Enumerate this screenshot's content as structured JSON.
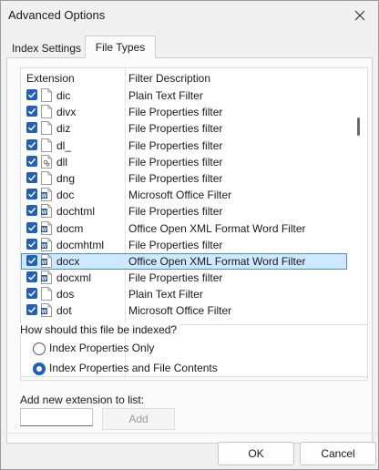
{
  "window": {
    "title": "Advanced Options"
  },
  "tabs": [
    {
      "label": "Index Settings",
      "active": false
    },
    {
      "label": "File Types",
      "active": true
    }
  ],
  "list": {
    "headers": {
      "extension": "Extension",
      "description": "Filter Description"
    },
    "rows": [
      {
        "ext": "dic",
        "desc": "Plain Text Filter",
        "checked": true,
        "icon": "blank-file-icon"
      },
      {
        "ext": "divx",
        "desc": "File Properties filter",
        "checked": true,
        "icon": "blank-file-icon"
      },
      {
        "ext": "diz",
        "desc": "File Properties filter",
        "checked": true,
        "icon": "blank-file-icon"
      },
      {
        "ext": "dl_",
        "desc": "File Properties filter",
        "checked": true,
        "icon": "blank-file-icon"
      },
      {
        "ext": "dll",
        "desc": "File Properties filter",
        "checked": true,
        "icon": "dll-file-icon"
      },
      {
        "ext": "dng",
        "desc": "File Properties filter",
        "checked": true,
        "icon": "blank-file-icon"
      },
      {
        "ext": "doc",
        "desc": "Microsoft Office Filter",
        "checked": true,
        "icon": "word-doc-icon"
      },
      {
        "ext": "dochtml",
        "desc": "File Properties filter",
        "checked": true,
        "icon": "word-doc-icon"
      },
      {
        "ext": "docm",
        "desc": "Office Open XML Format Word Filter",
        "checked": true,
        "icon": "word-doc-icon"
      },
      {
        "ext": "docmhtml",
        "desc": "File Properties filter",
        "checked": true,
        "icon": "word-doc-icon"
      },
      {
        "ext": "docx",
        "desc": "Office Open XML Format Word Filter",
        "checked": true,
        "icon": "word-doc-icon",
        "selected": true
      },
      {
        "ext": "docxml",
        "desc": "File Properties filter",
        "checked": true,
        "icon": "word-doc-icon"
      },
      {
        "ext": "dos",
        "desc": "Plain Text Filter",
        "checked": true,
        "icon": "blank-file-icon"
      },
      {
        "ext": "dot",
        "desc": "Microsoft Office Filter",
        "checked": true,
        "icon": "word-doc-icon"
      }
    ]
  },
  "indexing": {
    "question": "How should this file be indexed?",
    "options": [
      {
        "label": "Index Properties Only",
        "selected": false
      },
      {
        "label": "Index Properties and File Contents",
        "selected": true
      }
    ]
  },
  "add_extension": {
    "label": "Add new extension to list:",
    "value": "",
    "button_label": "Add"
  },
  "footer": {
    "ok_label": "OK",
    "cancel_label": "Cancel"
  },
  "colors": {
    "accent": "#1f5fbf",
    "selection": "#cde8ff"
  }
}
